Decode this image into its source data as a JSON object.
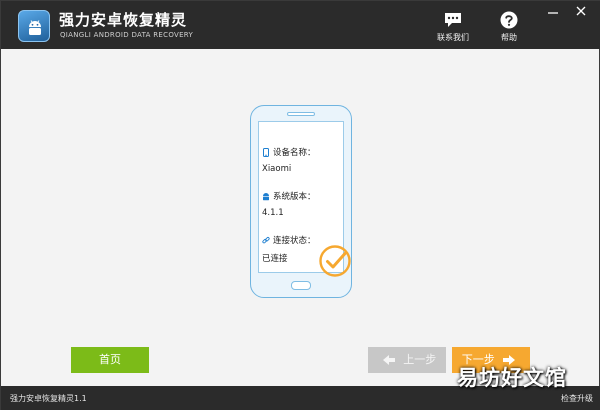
{
  "app": {
    "title": "强力安卓恢复精灵",
    "subtitle": "QIANGLI ANDROID DATA RECOVERY"
  },
  "toolbar": {
    "contact_label": "联系我们",
    "help_label": "帮助"
  },
  "device": {
    "name_label": "设备名称：",
    "name_value": "Xiaomi",
    "version_label": "系统版本：",
    "version_value": "4.1.1",
    "status_label": "连接状态：",
    "status_value": "已连接"
  },
  "buttons": {
    "home_label": "首页",
    "prev_label": "上一步",
    "next_label": "下一步"
  },
  "statusbar": {
    "version": "强力安卓恢复精灵1.1",
    "check_update": "检查升级"
  },
  "watermark": "易坊好文馆",
  "colors": {
    "titlebar": "#2b2b2b",
    "home_button": "#7cbb18",
    "next_button": "#f6a830",
    "prev_button": "#c7c7c7",
    "phone_outline": "#6fb4e0",
    "check": "#f6a830"
  },
  "icons": {
    "logo": "android-logo-icon",
    "contact": "chat-bubble-icon",
    "help": "question-circle-icon",
    "minimize": "minimize-icon",
    "close": "close-icon",
    "device": "phone-icon",
    "version": "android-icon",
    "connection": "link-icon",
    "connected": "checkmark-circle-icon"
  }
}
